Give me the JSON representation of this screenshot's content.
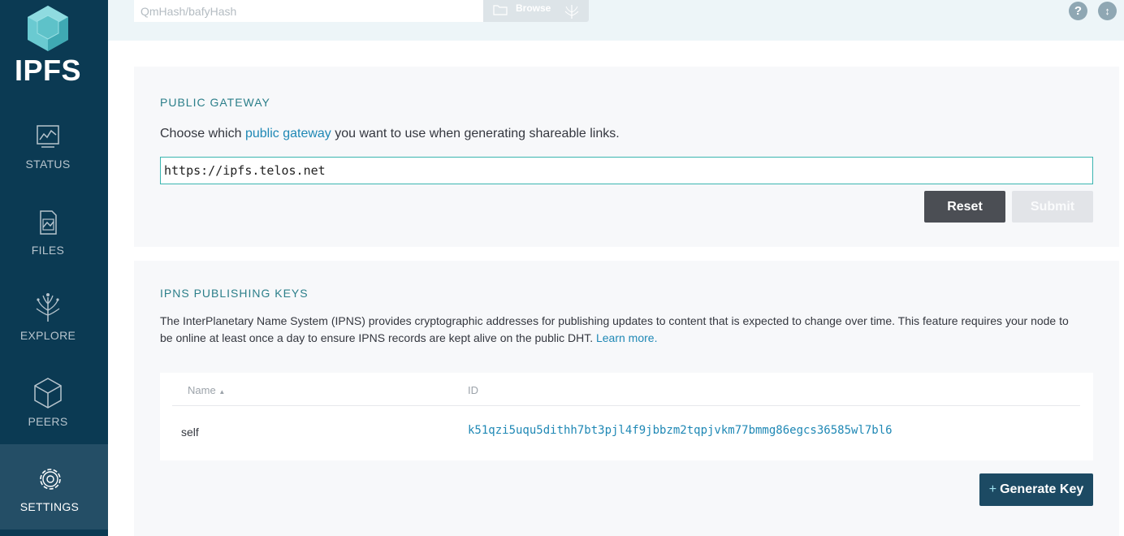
{
  "sidebar": {
    "logo_text": "IPFS",
    "items": [
      {
        "label": "STATUS",
        "icon": "status-chart-icon"
      },
      {
        "label": "FILES",
        "icon": "files-icon"
      },
      {
        "label": "EXPLORE",
        "icon": "explore-tree-icon"
      },
      {
        "label": "PEERS",
        "icon": "peers-cube-icon"
      },
      {
        "label": "SETTINGS",
        "icon": "gear-icon",
        "active": true
      }
    ]
  },
  "topbar": {
    "hash_placeholder": "QmHash/bafyHash",
    "browse_label": "Browse",
    "help_icon": "?",
    "sync_icon": "↕"
  },
  "gateway": {
    "title": "PUBLIC GATEWAY",
    "desc_before": "Choose which ",
    "desc_link": "public gateway",
    "desc_after": " you want to use when generating shareable links.",
    "value": "https://ipfs.telos.net",
    "reset_label": "Reset",
    "submit_label": "Submit"
  },
  "ipns": {
    "title": "IPNS PUBLISHING KEYS",
    "desc": "The InterPlanetary Name System (IPNS) provides cryptographic addresses for publishing updates to content that is expected to change over time. This feature requires your node to be online at least once a day to ensure IPNS records are kept alive on the public DHT. ",
    "learn_more": "Learn more.",
    "columns": {
      "name": "Name",
      "id": "ID"
    },
    "rows": [
      {
        "name": "self",
        "id": "k51qzi5uqu5dithh7bt3pjl4f9jbbzm2tqpjvkm77bmmg86egcs36585wl7bl6"
      }
    ],
    "generate_plus": "+",
    "generate_label": "Generate Key"
  },
  "colors": {
    "sidebar_bg": "#0b3a53",
    "sidebar_active": "#244e66",
    "accent_teal": "#2c7f8a",
    "link": "#1f88b5"
  }
}
